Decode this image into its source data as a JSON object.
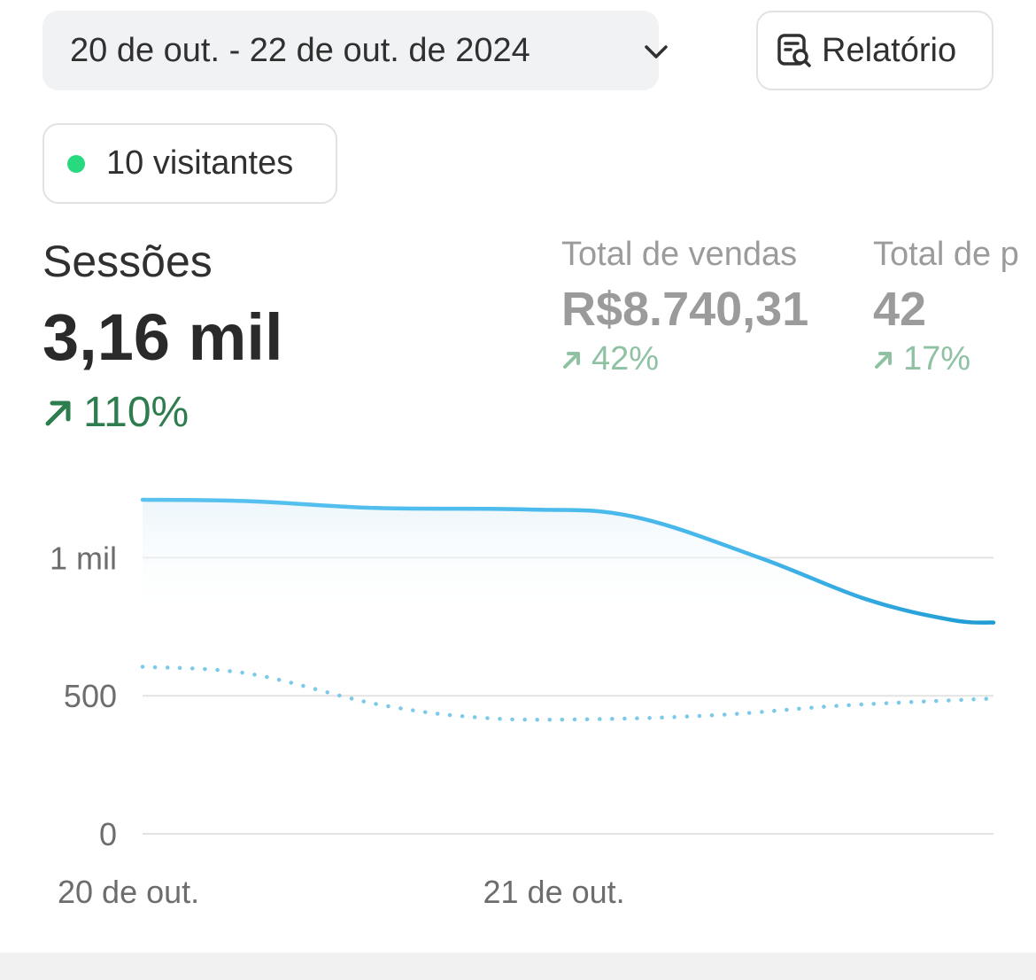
{
  "header": {
    "date_range": "20 de out. - 22 de out. de 2024",
    "report_label": "Relatório"
  },
  "live_visitors": {
    "label": "10 visitantes",
    "dot_color": "#29d980"
  },
  "metrics": {
    "primary": {
      "label": "Sessões",
      "value": "3,16 mil",
      "change": "110%",
      "change_color": "#2e7d4f"
    },
    "sales": {
      "label": "Total de vendas",
      "value": "R$8.740,31",
      "change": "42%"
    },
    "orders": {
      "label": "Total de p",
      "value": "42",
      "change": "17%"
    }
  },
  "chart_data": {
    "type": "line",
    "y_ticks": [
      {
        "value": 0,
        "label": "0"
      },
      {
        "value": 500,
        "label": "500"
      },
      {
        "value": 1000,
        "label": "1 mil"
      }
    ],
    "x_ticks": [
      {
        "x": 0,
        "label": "20 de out."
      },
      {
        "x": 1,
        "label": "21 de out."
      }
    ],
    "ylim": [
      0,
      1210
    ],
    "xlim": [
      0,
      2
    ],
    "grid": true,
    "series": [
      {
        "style": "solid",
        "color": "#4fc0ee",
        "points": [
          [
            0,
            1210
          ],
          [
            0.25,
            1205
          ],
          [
            0.55,
            1180
          ],
          [
            0.9,
            1175
          ],
          [
            1.15,
            1150
          ],
          [
            1.45,
            1000
          ],
          [
            1.7,
            850
          ],
          [
            1.9,
            775
          ],
          [
            2,
            765
          ]
        ]
      },
      {
        "style": "dotted",
        "color": "#7cc9ea",
        "points": [
          [
            0,
            605
          ],
          [
            0.25,
            580
          ],
          [
            0.55,
            470
          ],
          [
            0.8,
            420
          ],
          [
            1.05,
            415
          ],
          [
            1.35,
            430
          ],
          [
            1.65,
            465
          ],
          [
            2,
            490
          ]
        ]
      }
    ]
  }
}
